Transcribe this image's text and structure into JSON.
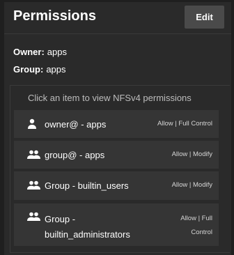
{
  "header": {
    "title": "Permissions",
    "edit_label": "Edit"
  },
  "info": {
    "owner_key": "Owner:",
    "owner_value": "apps",
    "group_key": "Group:",
    "group_value": "apps"
  },
  "hint": "Click an item to view NFSv4 permissions",
  "items": [
    {
      "icon": "person-icon",
      "name": "owner@ - apps",
      "perm": "Allow | Full Control"
    },
    {
      "icon": "people-icon",
      "name": "group@ - apps",
      "perm": "Allow | Modify"
    },
    {
      "icon": "people-icon",
      "name": "Group - builtin_users",
      "perm": "Allow | Modify"
    },
    {
      "icon": "people-icon",
      "name_line1": "Group -",
      "name_line2": "builtin_administrators",
      "perm_line1": "Allow | Full",
      "perm_line2": "Control"
    }
  ]
}
